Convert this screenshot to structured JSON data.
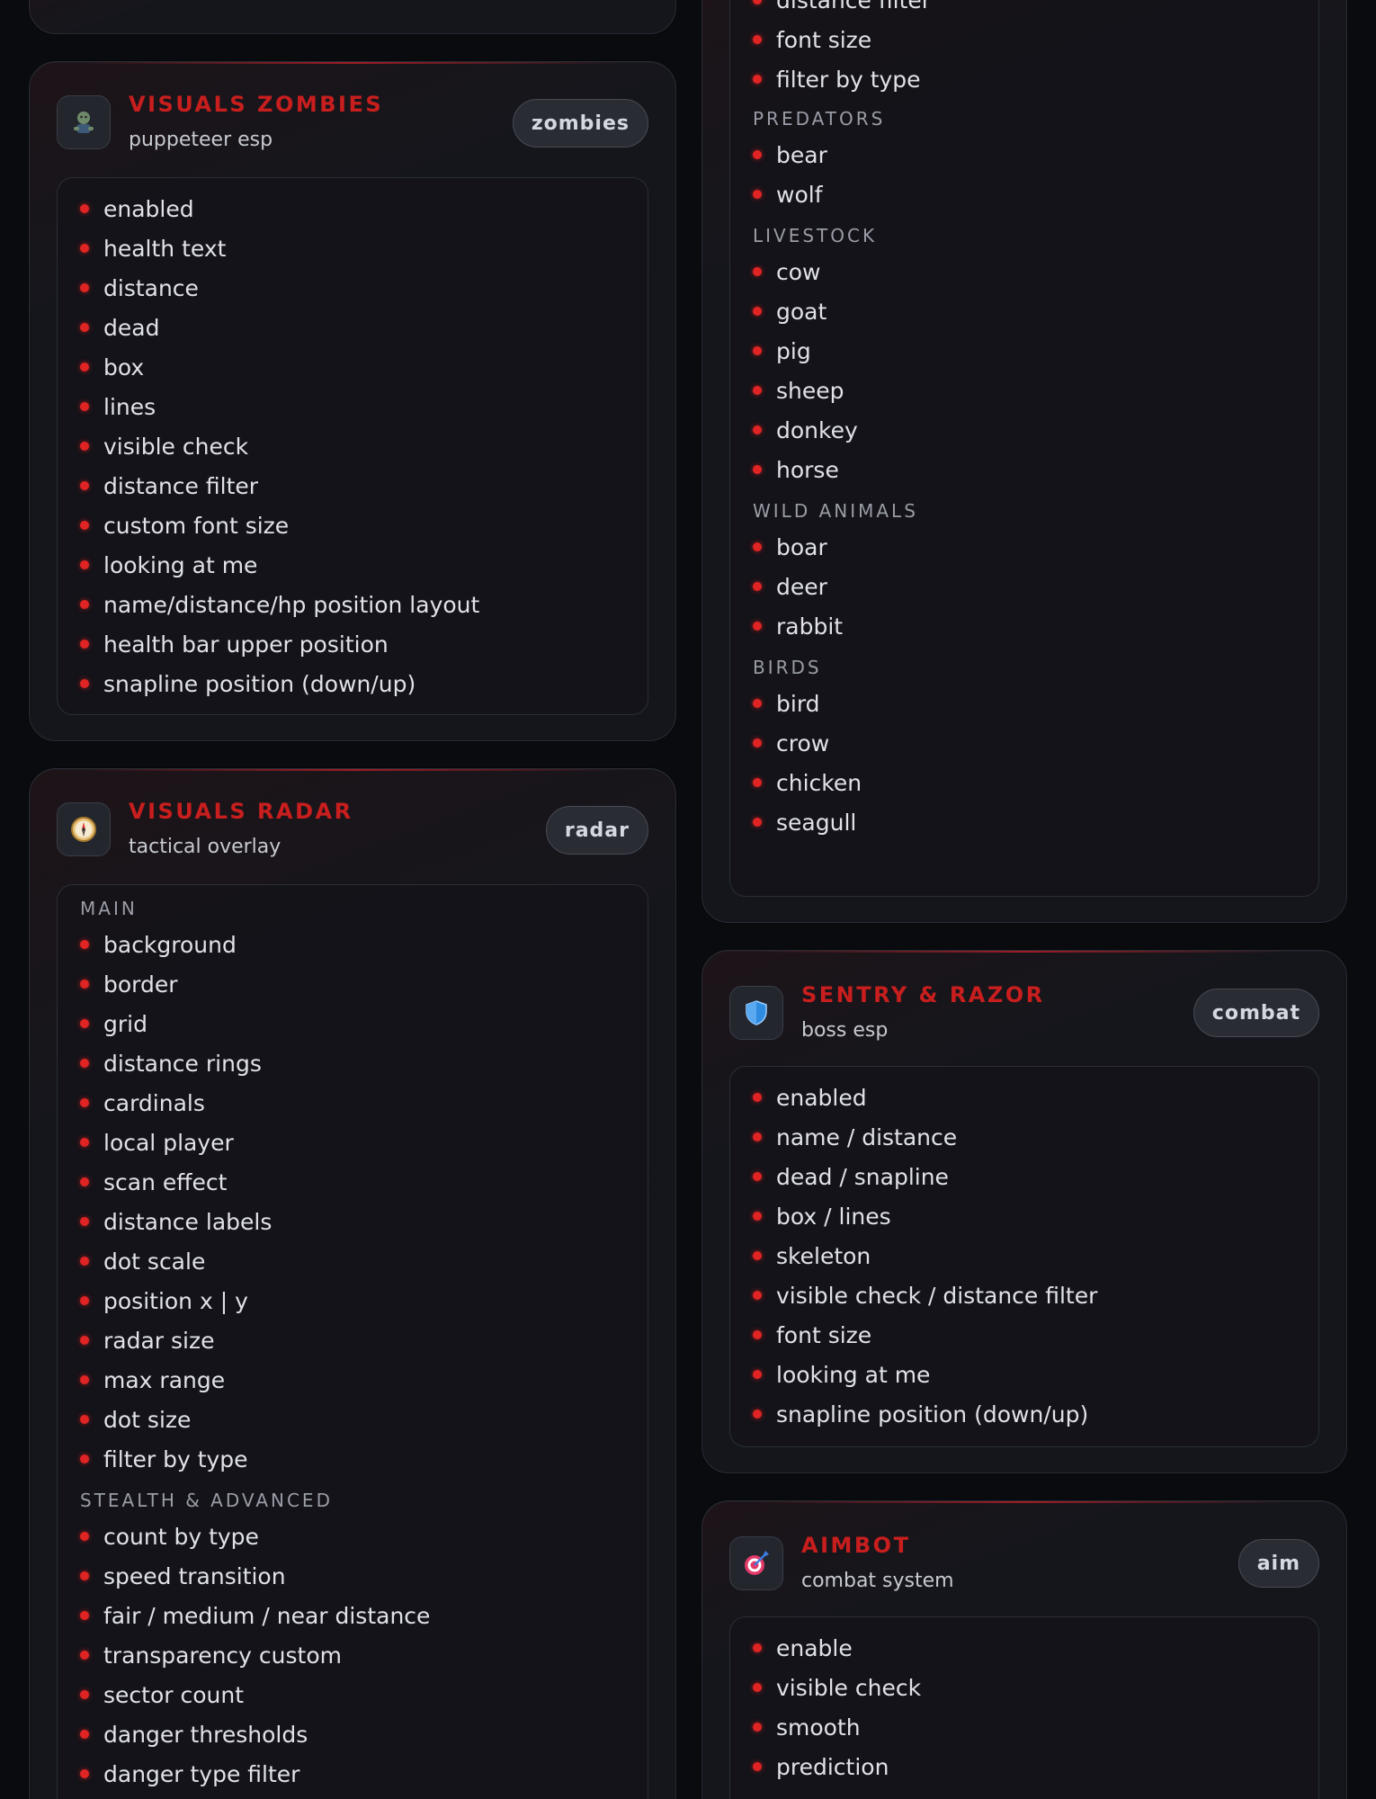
{
  "zombies": {
    "title": "VISUALS ZOMBIES",
    "subtitle": "puppeteer esp",
    "badge": "zombies",
    "icon": "zombie-icon",
    "items": [
      "enabled",
      "health text",
      "distance",
      "dead",
      "box",
      "lines",
      "visible check",
      "distance filter",
      "custom font size",
      "looking at me",
      "name/distance/hp position layout",
      "health bar upper position",
      "snapline position (down/up)"
    ]
  },
  "radar": {
    "title": "VISUALS RADAR",
    "subtitle": "tactical overlay",
    "badge": "radar",
    "icon": "compass-icon",
    "sections": [
      {
        "label": "MAIN",
        "items": [
          "background",
          "border",
          "grid",
          "distance rings",
          "cardinals",
          "local player",
          "scan effect",
          "distance labels",
          "dot scale",
          "position x | y",
          "radar size",
          "max range",
          "dot size",
          "filter by type"
        ]
      },
      {
        "label": "STEALTH & ADVANCED",
        "items": [
          "count by type",
          "speed transition",
          "fair / medium / near distance",
          "transparency custom",
          "sector count",
          "danger thresholds",
          "danger type filter"
        ]
      }
    ]
  },
  "animals": {
    "top_items": [
      "distance filter",
      "font size",
      "filter by type"
    ],
    "sections": [
      {
        "label": "PREDATORS",
        "items": [
          "bear",
          "wolf"
        ]
      },
      {
        "label": "LIVESTOCK",
        "items": [
          "cow",
          "goat",
          "pig",
          "sheep",
          "donkey",
          "horse"
        ]
      },
      {
        "label": "WILD ANIMALS",
        "items": [
          "boar",
          "deer",
          "rabbit"
        ]
      },
      {
        "label": "BIRDS",
        "items": [
          "bird",
          "crow",
          "chicken",
          "seagull"
        ]
      }
    ]
  },
  "sentry": {
    "title": "SENTRY & RAZOR",
    "subtitle": "boss esp",
    "badge": "combat",
    "icon": "shield-icon",
    "items": [
      "enabled",
      "name / distance",
      "dead / snapline",
      "box / lines",
      "skeleton",
      "visible check / distance filter",
      "font size",
      "looking at me",
      "snapline position (down/up)"
    ]
  },
  "aimbot": {
    "title": "AIMBOT",
    "subtitle": "combat system",
    "badge": "aim",
    "icon": "target-icon",
    "items": [
      "enable",
      "visible check",
      "smooth",
      "prediction"
    ]
  },
  "colors": {
    "accent": "#c81e1e",
    "bullet": "#e02424",
    "background": "#0a0b0f"
  }
}
